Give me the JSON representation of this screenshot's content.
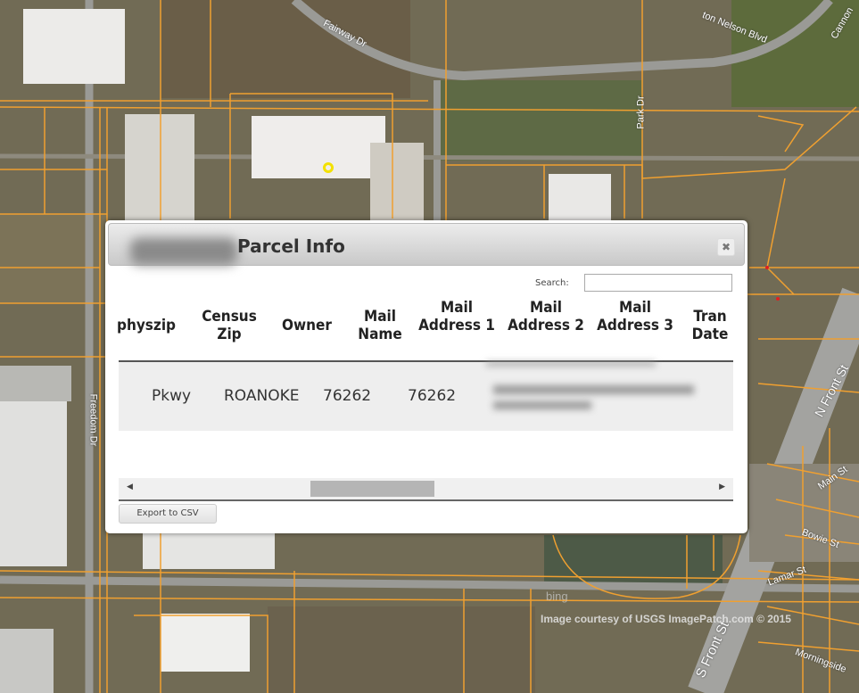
{
  "map": {
    "road_labels": [
      "Fairway Dr",
      "ton Nelson Blvd",
      "Cannon",
      "Park Dr",
      "Freedom Dr",
      "N Front St",
      "Main St",
      "Bowie St",
      "Lamar St",
      "S Front St",
      "Morningside"
    ],
    "attribution": "Image courtesy of USGS ImagePatch.com © 2015",
    "logo": "bing",
    "parcel_line_color": "#f0a030",
    "marker_color": "#f3e100"
  },
  "dialog": {
    "title": "Parcel Info",
    "close_icon": "close-icon",
    "search_label": "Search:",
    "search_value": "",
    "columns": [
      "physzip",
      "Census Zip",
      "Owner",
      "Mail Name",
      "Mail Address 1",
      "Mail Address 2",
      "Mail Address 3",
      "Tran Date"
    ],
    "row": [
      "Pkwy",
      "ROANOKE",
      "76262",
      "76262"
    ],
    "export_label": "Export to CSV"
  }
}
